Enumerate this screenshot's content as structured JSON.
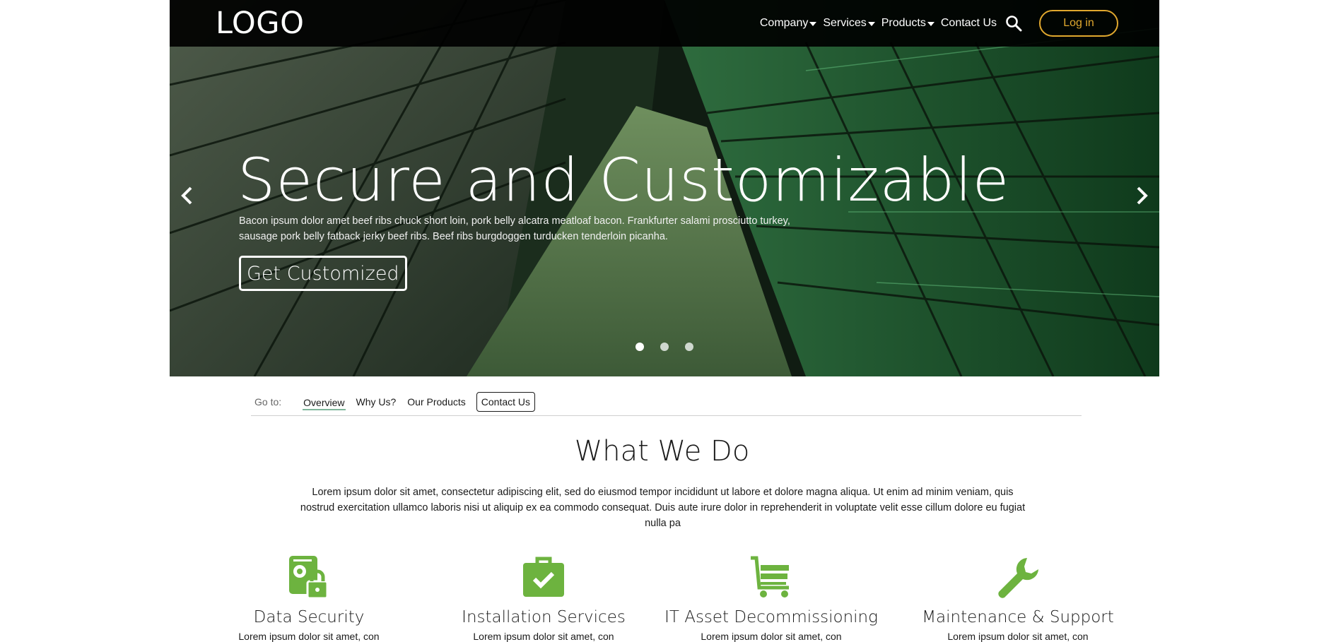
{
  "header": {
    "logo": "LOGO",
    "nav": [
      {
        "label": "Company",
        "dropdown": true
      },
      {
        "label": "Services",
        "dropdown": true
      },
      {
        "label": "Products",
        "dropdown": true
      },
      {
        "label": "Contact Us",
        "dropdown": false
      }
    ],
    "search_icon": "search-icon",
    "login_label": "Log in"
  },
  "hero": {
    "title": "Secure and Customizable",
    "text": "Bacon ipsum dolor amet beef ribs chuck short loin, pork belly alcatra meatloaf bacon. Frankfurter salami prosciutto turkey, sausage pork belly fatback jerky beef ribs. Beef ribs burgdoggen turducken tenderloin picanha.",
    "button_label": "Get Customized",
    "slides": 3,
    "active_slide": 1
  },
  "goto": {
    "label": "Go to:",
    "links": [
      "Overview",
      "Why Us?",
      "Our Products",
      "Contact Us"
    ],
    "active": "Overview"
  },
  "section": {
    "title": "What We Do",
    "text": "Lorem ipsum dolor sit amet, consectetur adipiscing elit, sed do eiusmod tempor incididunt ut labore et dolore magna aliqua. Ut enim ad minim veniam, quis nostrud exercitation ullamco laboris nisi ut aliquip ex ea commodo consequat. Duis aute irure dolor in reprehenderit in voluptate velit esse cillum dolore eu fugiat nulla pa"
  },
  "services": [
    {
      "name": "Data Security",
      "icon": "lock-device-icon",
      "desc": "Lorem ipsum dolor sit amet, con"
    },
    {
      "name": "Installation Services",
      "icon": "briefcase-check-icon",
      "desc": "Lorem ipsum dolor sit amet, con"
    },
    {
      "name": "IT Asset Decommissioning",
      "icon": "cart-icon",
      "desc": "Lorem ipsum dolor sit amet, con"
    },
    {
      "name": "Maintenance & Support",
      "icon": "wrench-icon",
      "desc": "Lorem ipsum dolor sit amet, con"
    }
  ],
  "colors": {
    "accent_green": "#6db33f",
    "login_gold": "#e0a82e",
    "header_bg": "#000000"
  }
}
